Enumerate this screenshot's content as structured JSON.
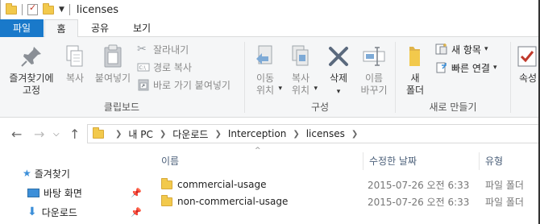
{
  "window": {
    "title": "licenses"
  },
  "ribbon_tabs": {
    "file": "파일",
    "home": "홈",
    "share": "공유",
    "view": "보기"
  },
  "clipboard": {
    "pin_label": "즐겨찾기에\n고정",
    "copy_label": "복사",
    "paste_label": "붙여넣기",
    "cut_label": "잘라내기",
    "copy_path_label": "경로 복사",
    "paste_shortcut_label": "바로 가기 붙여넣기",
    "group_label": "클립보드"
  },
  "organize": {
    "move_to_label": "이동\n위치",
    "copy_to_label": "복사\n위치",
    "delete_label": "삭제",
    "rename_label": "이름\n바꾸기",
    "group_label": "구성"
  },
  "new": {
    "new_folder_label": "새\n폴더",
    "new_item_label": "새 항목",
    "easy_access_label": "빠른 연결",
    "group_label": "새로 만들기"
  },
  "open": {
    "properties_label": "속성"
  },
  "breadcrumb": [
    "내 PC",
    "다운로드",
    "Interception",
    "licenses"
  ],
  "columns": {
    "name": "이름",
    "date": "수정한 날짜",
    "type": "유형"
  },
  "nav_pane": {
    "quick_access": "즐겨찾기",
    "desktop": "바탕 화면",
    "downloads": "다운로드"
  },
  "files": [
    {
      "name": "commercial-usage",
      "date": "2015-07-26 오전 6:33",
      "type": "파일 폴더"
    },
    {
      "name": "non-commercial-usage",
      "date": "2015-07-26 오전 6:33",
      "type": "파일 폴더"
    }
  ],
  "colors": {
    "file_tab": "#1979ca",
    "folder": "#f2c94c",
    "accent_icon": "#3c8fd9"
  }
}
